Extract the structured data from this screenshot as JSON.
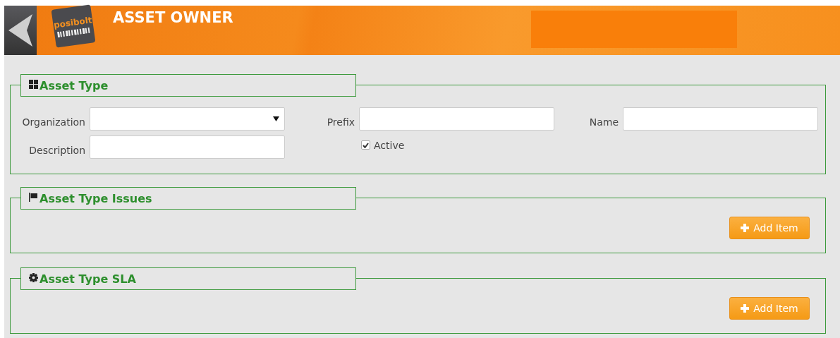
{
  "header": {
    "title": "ASSET OWNER",
    "logo_text": "posibolt"
  },
  "sections": [
    {
      "title": "Asset Type",
      "kind": "form",
      "fields": [
        {
          "label": "Organization",
          "kind": "select"
        },
        {
          "label": "Prefix",
          "kind": "text"
        },
        {
          "label": "Name",
          "kind": "text"
        },
        {
          "label": "Description",
          "kind": "text"
        },
        {
          "label": "Active",
          "kind": "checkbox",
          "checked": true
        }
      ]
    },
    {
      "title": "Asset Type Issues",
      "kind": "list",
      "button": "Add Item"
    },
    {
      "title": "Asset Type SLA",
      "kind": "list",
      "button": "Add Item"
    }
  ]
}
